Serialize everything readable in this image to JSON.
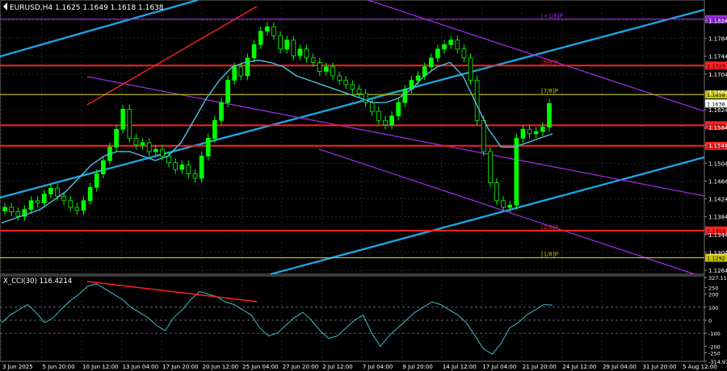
{
  "header": {
    "symbol_line": "EURUSD,H4  1.1625 1.1649 1.1618 1.1638",
    "indicator_line": "X_CCI(30) 116.4214"
  },
  "colors": {
    "background": "#000000",
    "grid": "#3a3a3a",
    "candle": "#00ff00",
    "ma": "#4dc3e0",
    "channel_blue": "#1fa3e0",
    "channel_purple": "#9a2ce0",
    "red_level": "#ff2020",
    "yellow_level": "#c8c800",
    "cci_line": "#3dc0d0",
    "divergence": "#ff2020",
    "axis_text": "#ffffff"
  },
  "chart_data": [
    {
      "type": "line",
      "panel": "price",
      "ylim": [
        1.2637,
        1.286
      ],
      "y_ticks": [
        "1.1824",
        "1.1784",
        "1.1744",
        "1.1704",
        "1.1664",
        "1.1624",
        "1.1584",
        "1.1544",
        "1.1504",
        "1.1464",
        "1.1424",
        "1.1384",
        "1.1344",
        "1.1304",
        "1.1264"
      ],
      "x_ticks": [
        "3 Jun 2025",
        "5 Jun 20:00",
        "10 Jun 12:00",
        "13 Jun 04:00",
        "17 Jun 20:00",
        "20 Jun 12:00",
        "25 Jun 04:00",
        "27 Jun 20:00",
        "2 Jul 12:00",
        "7 Jul 04:00",
        "9 Jul 20:00",
        "14 Jul 12:00",
        "17 Jul 04:00",
        "21 Jul 20:00",
        "24 Jul 12:00",
        "29 Jul 04:00",
        "31 Jul 20:00",
        "5 Aug 12:00"
      ],
      "series": [
        {
          "kind": "candles",
          "values": [
            1.1405,
            1.1395,
            1.1385,
            1.14,
            1.142,
            1.1415,
            1.1435,
            1.1448,
            1.143,
            1.142,
            1.1405,
            1.1398,
            1.142,
            1.145,
            1.148,
            1.151,
            1.154,
            1.158,
            1.1625,
            1.156,
            1.1545,
            1.155,
            1.153,
            1.1535,
            1.152,
            1.1505,
            1.149,
            1.15,
            1.148,
            1.147,
            1.152,
            1.156,
            1.16,
            1.164,
            1.169,
            1.172,
            1.17,
            1.174,
            1.177,
            1.18,
            1.181,
            1.179,
            1.176,
            1.178,
            1.1745,
            1.176,
            1.174,
            1.173,
            1.171,
            1.172,
            1.17,
            1.169,
            1.168,
            1.167,
            1.166,
            1.164,
            1.162,
            1.16,
            1.159,
            1.161,
            1.164,
            1.167,
            1.169,
            1.17,
            1.172,
            1.174,
            1.176,
            1.177,
            1.178,
            1.176,
            1.174,
            1.169,
            1.16,
            1.153,
            1.146,
            1.142,
            1.1405,
            1.141,
            1.156,
            1.158,
            1.157,
            1.1575,
            1.1585,
            1.1638
          ]
        },
        {
          "kind": "ma",
          "name": "",
          "values": [
            1.137,
            1.138,
            1.139,
            1.14,
            1.142,
            1.144,
            1.147,
            1.15,
            1.152,
            1.153,
            1.153,
            1.152,
            1.151,
            1.152,
            1.155,
            1.16,
            1.165,
            1.169,
            1.172,
            1.173,
            1.1735,
            1.173,
            1.172,
            1.17,
            1.169,
            1.168,
            1.167,
            1.166,
            1.165,
            1.164,
            1.164,
            1.165,
            1.167,
            1.17,
            1.172,
            1.173,
            1.17,
            1.164,
            1.158,
            1.154,
            1.154,
            1.155,
            1.156,
            1.157
          ]
        }
      ],
      "levels": [
        {
          "value": 1.1827,
          "color": "#9a2ce0",
          "label": "[+1/8]P",
          "badge": "1.1827"
        },
        {
          "value": 1.1723,
          "color": "#ff2020",
          "label": "[8/8]P",
          "badge": "1.1723"
        },
        {
          "value": 1.1658,
          "color": "#c8c800",
          "label": "[7/8]P",
          "badge": "1.1658"
        },
        {
          "value": 1.1589,
          "color": "#ff2020",
          "label": "",
          "badge": "1.1589"
        },
        {
          "value": 1.1543,
          "color": "#ff2020",
          "label": "",
          "badge": "1.1543"
        },
        {
          "value": 1.1353,
          "color": "#ff2020",
          "label": "[2/8]P",
          "badge": "1.1353"
        },
        {
          "value": 1.1292,
          "color": "#c8c800",
          "label": "[1/8]P",
          "badge": "1.1292"
        }
      ],
      "last_price": "1.1638"
    },
    {
      "type": "line",
      "panel": "indicator",
      "name": "X_CCI(30)",
      "ylim": [
        -315,
        340
      ],
      "y_ticks": [
        "327.116",
        "250",
        "200",
        "100",
        "0",
        "-100",
        "-200",
        "-250",
        "-314.975"
      ],
      "values": [
        -20,
        40,
        80,
        120,
        60,
        -20,
        20,
        90,
        150,
        200,
        260,
        280,
        240,
        200,
        160,
        100,
        60,
        20,
        -40,
        -80,
        20,
        80,
        160,
        220,
        200,
        180,
        140,
        120,
        80,
        40,
        -60,
        -120,
        -100,
        -40,
        20,
        60,
        0,
        -80,
        -140,
        -120,
        -60,
        0,
        40,
        -100,
        -200,
        -120,
        -60,
        0,
        60,
        100,
        140,
        120,
        80,
        40,
        -20,
        -120,
        -220,
        -260,
        -180,
        -60,
        -20,
        40,
        80,
        120,
        116
      ]
    }
  ]
}
